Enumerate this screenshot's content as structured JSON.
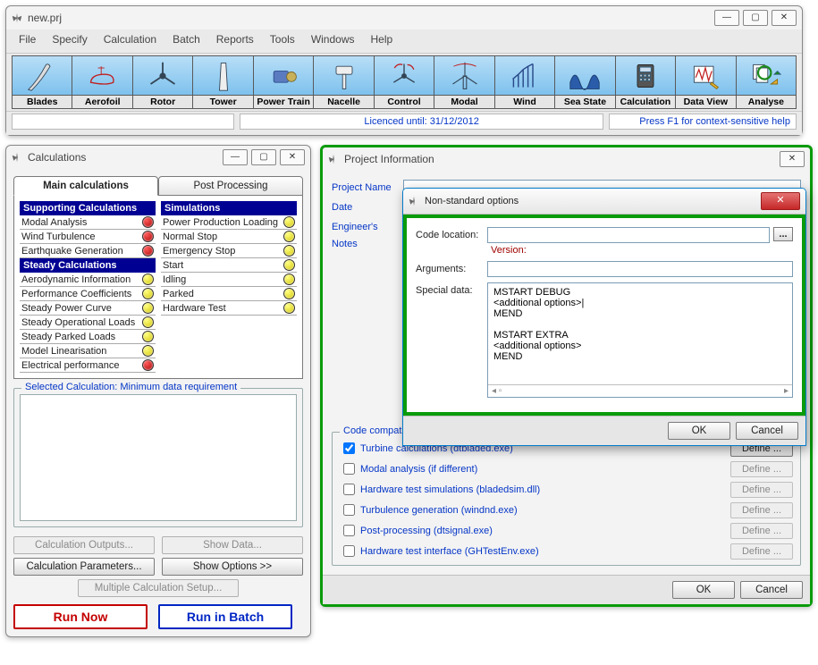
{
  "main": {
    "title": "new.prj",
    "menu": [
      "File",
      "Specify",
      "Calculation",
      "Batch",
      "Reports",
      "Tools",
      "Windows",
      "Help"
    ],
    "tools": [
      "Blades",
      "Aerofoil",
      "Rotor",
      "Tower",
      "Power Train",
      "Nacelle",
      "Control",
      "Modal",
      "Wind",
      "Sea State",
      "Calculation",
      "Data View",
      "Analyse"
    ],
    "licence": "Licenced until: 31/12/2012",
    "helphint": "Press F1 for context-sensitive help"
  },
  "calc": {
    "title": "Calculations",
    "tabs": {
      "main": "Main calculations",
      "post": "Post Processing"
    },
    "supp_hdr": "Supporting Calculations",
    "supp": [
      {
        "label": "Modal Analysis",
        "dot": "red"
      },
      {
        "label": "Wind Turbulence",
        "dot": "red"
      },
      {
        "label": "Earthquake Generation",
        "dot": "red"
      }
    ],
    "steady_hdr": "Steady Calculations",
    "steady": [
      {
        "label": "Aerodynamic Information",
        "dot": "yellow"
      },
      {
        "label": "Performance Coefficients",
        "dot": "yellow"
      },
      {
        "label": "Steady Power Curve",
        "dot": "yellow"
      },
      {
        "label": "Steady Operational Loads",
        "dot": "yellow"
      },
      {
        "label": "Steady Parked Loads",
        "dot": "yellow"
      },
      {
        "label": "Model Linearisation",
        "dot": "yellow"
      },
      {
        "label": "Electrical performance",
        "dot": "red"
      }
    ],
    "sim_hdr": "Simulations",
    "sim": [
      {
        "label": "Power Production Loading",
        "dot": "yellow"
      },
      {
        "label": "Normal Stop",
        "dot": "yellow"
      },
      {
        "label": "Emergency Stop",
        "dot": "yellow"
      },
      {
        "label": "Start",
        "dot": "yellow"
      },
      {
        "label": "Idling",
        "dot": "yellow"
      },
      {
        "label": "Parked",
        "dot": "yellow"
      },
      {
        "label": "Hardware Test",
        "dot": "yellow"
      }
    ],
    "selected_legend": "Selected Calculation: Minimum data requirement",
    "btns": {
      "outputs": "Calculation Outputs...",
      "params": "Calculation Parameters...",
      "showdata": "Show Data...",
      "showopts": "Show Options >>",
      "multi": "Multiple Calculation Setup...",
      "runnow": "Run Now",
      "runbatch": "Run in Batch"
    }
  },
  "pi": {
    "title": "Project Information",
    "fields": {
      "name": "Project Name",
      "date": "Date",
      "eng": "Engineer's",
      "notes": "Notes"
    },
    "code_legend": "Code compatibility and non-standard options",
    "code": [
      {
        "label": "Turbine calculations (dtbladed.exe)",
        "checked": true,
        "enabled": true
      },
      {
        "label": "Modal analysis (if different)",
        "checked": false,
        "enabled": false
      },
      {
        "label": "Hardware test simulations (bladedsim.dll)",
        "checked": false,
        "enabled": false
      },
      {
        "label": "Turbulence generation (windnd.exe)",
        "checked": false,
        "enabled": false
      },
      {
        "label": "Post-processing (dtsignal.exe)",
        "checked": false,
        "enabled": false
      },
      {
        "label": "Hardware test interface (GHTestEnv.exe)",
        "checked": false,
        "enabled": false
      }
    ],
    "define": "Define ...",
    "ok": "OK",
    "cancel": "Cancel"
  },
  "ns": {
    "title": "Non-standard options",
    "codeloc": "Code location:",
    "version": "Version:",
    "args": "Arguments:",
    "special_label": "Special data:",
    "special_text": "MSTART DEBUG\n<additional options>|\nMEND\n\nMSTART EXTRA\n<additional options>\nMEND",
    "ok": "OK",
    "cancel": "Cancel",
    "browse": "..."
  }
}
